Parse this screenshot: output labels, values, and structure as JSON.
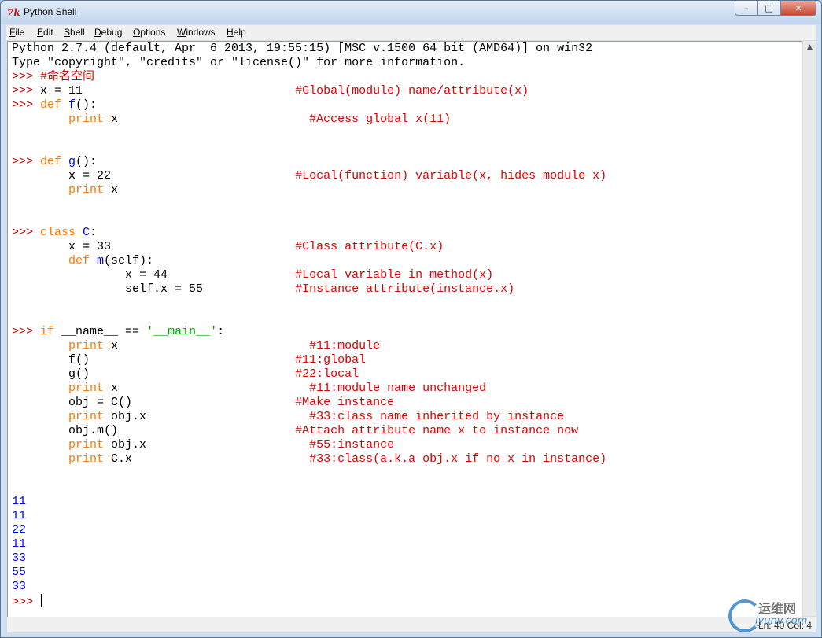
{
  "window": {
    "title": "Python Shell",
    "icon": "tk-feather-icon"
  },
  "window_controls": {
    "minimize": "–",
    "maximize": "□",
    "close": "✕"
  },
  "menu": [
    "File",
    "Edit",
    "Shell",
    "Debug",
    "Options",
    "Windows",
    "Help"
  ],
  "editor": {
    "lines": [
      [
        {
          "t": "Python 2.7.4 (default, Apr  6 2013, 19:55:15) [MSC v.1500 64 bit (AMD64)] on win32"
        }
      ],
      [
        {
          "t": "Type \"copyright\", \"credits\" or \"license()\" for more information."
        }
      ],
      [
        {
          "t": ">>> ",
          "c": "pr"
        },
        {
          "t": "#命名空间",
          "c": "cm"
        }
      ],
      [
        {
          "t": ">>> ",
          "c": "pr"
        },
        {
          "t": "x = 11                              "
        },
        {
          "t": "#Global(module) name/attribute(x)",
          "c": "cm"
        }
      ],
      [
        {
          "t": ">>> ",
          "c": "pr"
        },
        {
          "t": "def ",
          "c": "kw"
        },
        {
          "t": "f",
          "c": "fn"
        },
        {
          "t": "():"
        }
      ],
      [
        {
          "t": "        "
        },
        {
          "t": "print",
          "c": "kw"
        },
        {
          "t": " x                           "
        },
        {
          "t": "#Access global x(11)",
          "c": "cm"
        }
      ],
      [
        {
          "t": ""
        }
      ],
      [
        {
          "t": ""
        }
      ],
      [
        {
          "t": ">>> ",
          "c": "pr"
        },
        {
          "t": "def ",
          "c": "kw"
        },
        {
          "t": "g",
          "c": "fn"
        },
        {
          "t": "():"
        }
      ],
      [
        {
          "t": "        x = 22                          "
        },
        {
          "t": "#Local(function) variable(x, hides module x)",
          "c": "cm"
        }
      ],
      [
        {
          "t": "        "
        },
        {
          "t": "print",
          "c": "kw"
        },
        {
          "t": " x"
        }
      ],
      [
        {
          "t": ""
        }
      ],
      [
        {
          "t": ""
        }
      ],
      [
        {
          "t": ">>> ",
          "c": "pr"
        },
        {
          "t": "class ",
          "c": "kw"
        },
        {
          "t": "C",
          "c": "fn"
        },
        {
          "t": ":"
        }
      ],
      [
        {
          "t": "        x = 33                          "
        },
        {
          "t": "#Class attribute(C.x)",
          "c": "cm"
        }
      ],
      [
        {
          "t": "        "
        },
        {
          "t": "def ",
          "c": "kw"
        },
        {
          "t": "m",
          "c": "fn"
        },
        {
          "t": "(self):"
        }
      ],
      [
        {
          "t": "                x = 44                  "
        },
        {
          "t": "#Local variable in method(x)",
          "c": "cm"
        }
      ],
      [
        {
          "t": "                self.x = 55             "
        },
        {
          "t": "#Instance attribute(instance.x)",
          "c": "cm"
        }
      ],
      [
        {
          "t": ""
        }
      ],
      [
        {
          "t": ""
        }
      ],
      [
        {
          "t": ">>> ",
          "c": "pr"
        },
        {
          "t": "if",
          "c": "kw"
        },
        {
          "t": " __name__ == "
        },
        {
          "t": "'__main__'",
          "c": "st"
        },
        {
          "t": ":"
        }
      ],
      [
        {
          "t": "        "
        },
        {
          "t": "print",
          "c": "kw"
        },
        {
          "t": " x                           "
        },
        {
          "t": "#11:module",
          "c": "cm"
        }
      ],
      [
        {
          "t": "        f()                             "
        },
        {
          "t": "#11:global",
          "c": "cm"
        }
      ],
      [
        {
          "t": "        g()                             "
        },
        {
          "t": "#22:local",
          "c": "cm"
        }
      ],
      [
        {
          "t": "        "
        },
        {
          "t": "print",
          "c": "kw"
        },
        {
          "t": " x                           "
        },
        {
          "t": "#11:module name unchanged",
          "c": "cm"
        }
      ],
      [
        {
          "t": "        obj = C()                       "
        },
        {
          "t": "#Make instance",
          "c": "cm"
        }
      ],
      [
        {
          "t": "        "
        },
        {
          "t": "print",
          "c": "kw"
        },
        {
          "t": " obj.x                       "
        },
        {
          "t": "#33:class name inherited by instance",
          "c": "cm"
        }
      ],
      [
        {
          "t": "        obj.m()                         "
        },
        {
          "t": "#Attach attribute name x to instance now",
          "c": "cm"
        }
      ],
      [
        {
          "t": "        "
        },
        {
          "t": "print",
          "c": "kw"
        },
        {
          "t": " obj.x                       "
        },
        {
          "t": "#55:instance",
          "c": "cm"
        }
      ],
      [
        {
          "t": "        "
        },
        {
          "t": "print",
          "c": "kw"
        },
        {
          "t": " C.x                         "
        },
        {
          "t": "#33:class(a.k.a obj.x if no x in instance)",
          "c": "cm"
        }
      ],
      [
        {
          "t": ""
        }
      ],
      [
        {
          "t": ""
        }
      ],
      [
        {
          "t": "11",
          "c": "out"
        }
      ],
      [
        {
          "t": "11",
          "c": "out"
        }
      ],
      [
        {
          "t": "22",
          "c": "out"
        }
      ],
      [
        {
          "t": "11",
          "c": "out"
        }
      ],
      [
        {
          "t": "33",
          "c": "out"
        }
      ],
      [
        {
          "t": "55",
          "c": "out"
        }
      ],
      [
        {
          "t": "33",
          "c": "out"
        }
      ],
      [
        {
          "t": ">>> ",
          "c": "pr"
        },
        {
          "caret": true
        }
      ]
    ]
  },
  "status": {
    "position": "Ln: 40 Col: 4"
  },
  "watermark": {
    "text": "运维网",
    "sub": "iyunv.com"
  }
}
